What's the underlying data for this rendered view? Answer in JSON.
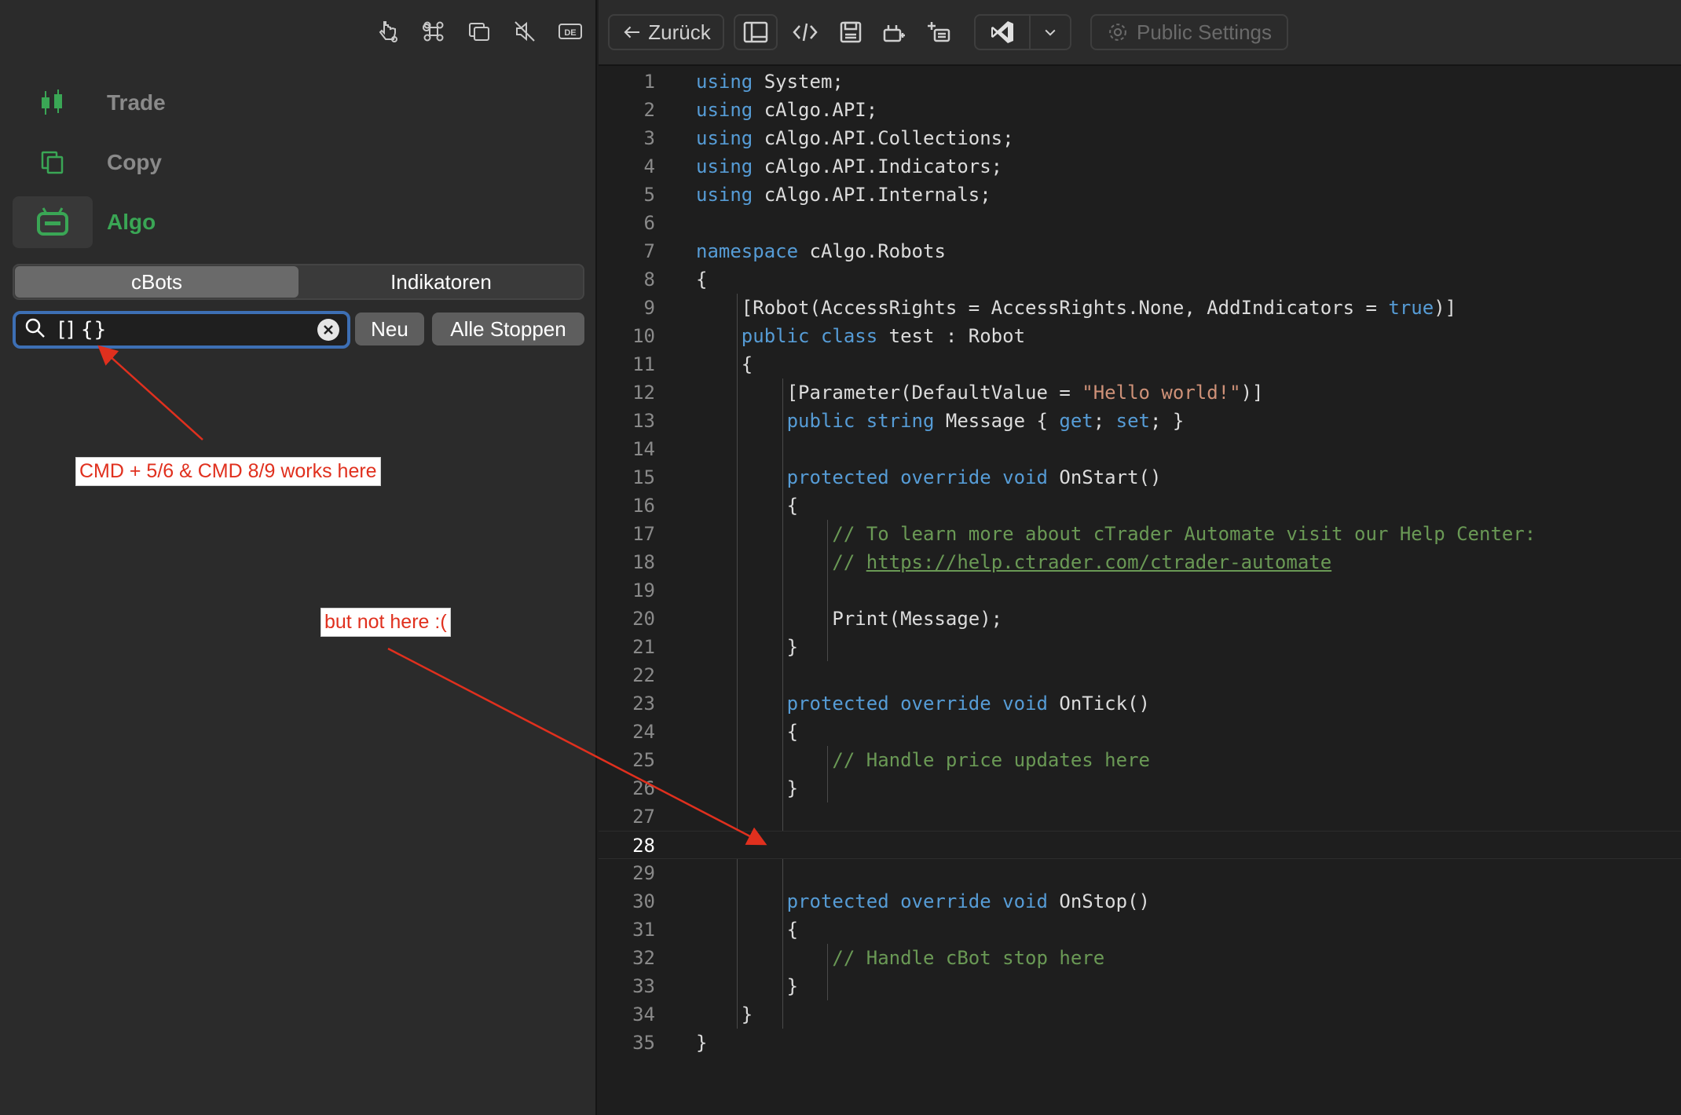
{
  "left_panel": {
    "nav": [
      {
        "label": "Trade",
        "icon": "candlestick-icon"
      },
      {
        "label": "Copy",
        "icon": "copy-icon"
      },
      {
        "label": "Algo",
        "icon": "robot-icon",
        "active": true
      }
    ],
    "tabs": [
      "cBots",
      "Indikatoren"
    ],
    "search": {
      "value": "[] {}"
    },
    "buttons": {
      "new": "Neu",
      "stop_all": "Alle Stoppen"
    }
  },
  "annotations": {
    "works": "CMD + 5/6 & CMD 8/9 works here",
    "not_here": "but not here :("
  },
  "toolbar": {
    "back": "Zurück",
    "public_settings": "Public Settings"
  },
  "colors": {
    "accent_green": "#3aa655",
    "keyword": "#569cd6",
    "comment": "#6a9955",
    "string": "#ce9178",
    "annotation_red": "#e0301e",
    "search_focus": "#3d6fb4"
  },
  "editor": {
    "current_line": 28,
    "lines": [
      {
        "n": "1",
        "segs": [
          [
            "kw",
            "using"
          ],
          [
            "",
            "System;"
          ]
        ]
      },
      {
        "n": "2",
        "segs": [
          [
            "kw",
            "using"
          ],
          [
            "",
            "cAlgo.API;"
          ]
        ]
      },
      {
        "n": "3",
        "segs": [
          [
            "kw",
            "using"
          ],
          [
            "",
            "cAlgo.API.Collections;"
          ]
        ]
      },
      {
        "n": "4",
        "segs": [
          [
            "kw",
            "using"
          ],
          [
            "",
            "cAlgo.API.Indicators;"
          ]
        ]
      },
      {
        "n": "5",
        "segs": [
          [
            "kw",
            "using"
          ],
          [
            "",
            "cAlgo.API.Internals;"
          ]
        ]
      },
      {
        "n": "6",
        "segs": []
      },
      {
        "n": "7",
        "segs": [
          [
            "kw",
            "namespace"
          ],
          [
            "",
            " cAlgo.Robots"
          ]
        ]
      },
      {
        "n": "8",
        "segs": [
          [
            "",
            "{"
          ]
        ]
      },
      {
        "n": "9",
        "segs": [
          [
            "",
            "    [Robot(AccessRights = AccessRights.None, AddIndicators = "
          ],
          [
            "kw",
            "true"
          ],
          [
            "",
            ")]"
          ]
        ]
      },
      {
        "n": "10",
        "segs": [
          [
            "kw",
            "    public class"
          ],
          [
            "",
            " test : Robot"
          ]
        ]
      },
      {
        "n": "11",
        "segs": [
          [
            "",
            "    {"
          ]
        ]
      },
      {
        "n": "12",
        "segs": [
          [
            "",
            "        [Parameter(DefaultValue = "
          ],
          [
            "st",
            "\"Hello world!\""
          ],
          [
            "",
            ")]"
          ]
        ]
      },
      {
        "n": "13",
        "segs": [
          [
            "kw",
            "        public string"
          ],
          [
            "",
            " Message { "
          ],
          [
            "kw",
            "get"
          ],
          [
            "",
            "; "
          ],
          [
            "kw",
            "set"
          ],
          [
            "",
            "; }"
          ]
        ]
      },
      {
        "n": "14",
        "segs": []
      },
      {
        "n": "15",
        "segs": [
          [
            "kw",
            "        protected override void"
          ],
          [
            "",
            " OnStart()"
          ]
        ]
      },
      {
        "n": "16",
        "segs": [
          [
            "",
            "        {"
          ]
        ]
      },
      {
        "n": "17",
        "segs": [
          [
            "cm",
            "            // To learn more about cTrader Automate visit our Help Center:"
          ]
        ]
      },
      {
        "n": "18",
        "segs": [
          [
            "cm",
            "            // "
          ],
          [
            "url",
            "https://help.ctrader.com/ctrader-automate"
          ]
        ]
      },
      {
        "n": "19",
        "segs": []
      },
      {
        "n": "20",
        "segs": [
          [
            "",
            "            Print(Message);"
          ]
        ]
      },
      {
        "n": "21",
        "segs": [
          [
            "",
            "        }"
          ]
        ]
      },
      {
        "n": "22",
        "segs": []
      },
      {
        "n": "23",
        "segs": [
          [
            "kw",
            "        protected override void"
          ],
          [
            "",
            " OnTick()"
          ]
        ]
      },
      {
        "n": "24",
        "segs": [
          [
            "",
            "        {"
          ]
        ]
      },
      {
        "n": "25",
        "segs": [
          [
            "cm",
            "            // Handle price updates here"
          ]
        ]
      },
      {
        "n": "26",
        "segs": [
          [
            "",
            "        }"
          ]
        ]
      },
      {
        "n": "27",
        "segs": []
      },
      {
        "n": "28",
        "segs": []
      },
      {
        "n": "29",
        "segs": []
      },
      {
        "n": "30",
        "segs": [
          [
            "kw",
            "        protected override void"
          ],
          [
            "",
            " OnStop()"
          ]
        ]
      },
      {
        "n": "31",
        "segs": [
          [
            "",
            "        {"
          ]
        ]
      },
      {
        "n": "32",
        "segs": [
          [
            "cm",
            "            // Handle cBot stop here"
          ]
        ]
      },
      {
        "n": "33",
        "segs": [
          [
            "",
            "        }"
          ]
        ]
      },
      {
        "n": "34",
        "segs": [
          [
            "",
            "    }"
          ]
        ]
      },
      {
        "n": "35",
        "segs": [
          [
            "",
            "}"
          ]
        ]
      }
    ]
  }
}
